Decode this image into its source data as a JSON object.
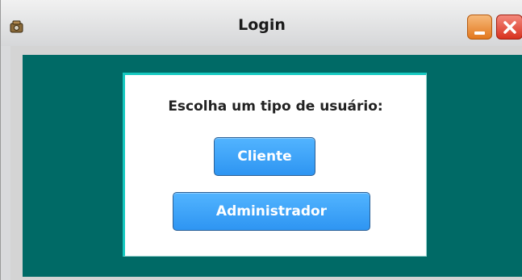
{
  "window": {
    "title": "Login"
  },
  "dialog": {
    "prompt": "Escolha um tipo de usuário:",
    "buttons": {
      "cliente": "Cliente",
      "administrador": "Administrador"
    }
  },
  "icons": {
    "app": "app-icon",
    "minimize": "minimize-icon",
    "close": "close-icon"
  },
  "colors": {
    "content_background": "#006a66",
    "panel_border": "#15c9c0",
    "button": "#3fa6f9",
    "minimize": "#e98a30",
    "close": "#e0402c"
  }
}
